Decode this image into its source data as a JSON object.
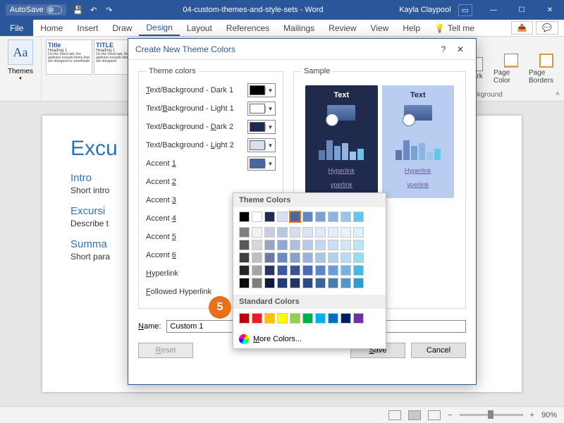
{
  "titlebar": {
    "autosave": "AutoSave",
    "document": "04-custom-themes-and-style-sets - Word",
    "user": "Kayla Claypool"
  },
  "tabs": [
    "File",
    "Home",
    "Insert",
    "Draw",
    "Design",
    "Layout",
    "References",
    "Mailings",
    "Review",
    "View",
    "Help"
  ],
  "active_tab": "Design",
  "tellme": "Tell me",
  "ribbon": {
    "themes": "Themes",
    "style1_title": "Title",
    "style1_h": "Heading 1",
    "style2_title": "TITLE",
    "style2_h": "Heading 1",
    "watermark": "nark",
    "pagecolor": "Page Color",
    "borders": "Page Borders",
    "group": "age Background"
  },
  "doc": {
    "h1": "Excu",
    "h2a": "Intro",
    "p1": "Short intro",
    "h2b": "Excursi",
    "p2": "Describe t",
    "h2c": "Summa",
    "p3": "Short para"
  },
  "dialog": {
    "title": "Create New Theme Colors",
    "themecolors": "Theme colors",
    "sample": "Sample",
    "rows": [
      {
        "label_pre": "",
        "u": "T",
        "label_post": "ext/Background - Dark 1",
        "color": "#000000"
      },
      {
        "label_pre": "Text/",
        "u": "B",
        "label_post": "ackground - Light 1",
        "color": "#ffffff"
      },
      {
        "label_pre": "Text/Background - ",
        "u": "D",
        "label_post": "ark 2",
        "color": "#1f2a4d"
      },
      {
        "label_pre": "Text/Background - ",
        "u": "L",
        "label_post": "ight 2",
        "color": "#d6e0f0"
      },
      {
        "label_pre": "Accent ",
        "u": "1",
        "label_post": "",
        "color": "#4a66a0"
      },
      {
        "label_pre": "Accent ",
        "u": "2",
        "label_post": "",
        "color": ""
      },
      {
        "label_pre": "Accent ",
        "u": "3",
        "label_post": "",
        "color": ""
      },
      {
        "label_pre": "Accent ",
        "u": "4",
        "label_post": "",
        "color": ""
      },
      {
        "label_pre": "Accent ",
        "u": "5",
        "label_post": "",
        "color": ""
      },
      {
        "label_pre": "Accent ",
        "u": "6",
        "label_post": "",
        "color": ""
      },
      {
        "label_pre": "",
        "u": "H",
        "label_post": "yperlink",
        "color": ""
      },
      {
        "label_pre": "",
        "u": "F",
        "label_post": "ollowed Hyperlink",
        "color": "#4aa0d8"
      }
    ],
    "sample_text": "Text",
    "sample_hl": "Hyperlink",
    "sample_fhl": "yperlink",
    "name_label": "Name:",
    "name_value": "Custom 1",
    "reset": "Reset",
    "save": "Save",
    "cancel": "Cancel"
  },
  "picker": {
    "theme_hdr": "Theme Colors",
    "std_hdr": "Standard Colors",
    "more": "More Colors...",
    "theme_row1": [
      "#000000",
      "#ffffff",
      "#1f2a4d",
      "#d6e0f0",
      "#4a66a0",
      "#6385c0",
      "#7ba0d4",
      "#8fb5de",
      "#9ec5e6",
      "#66c5e8"
    ],
    "tints": [
      [
        "#7f7f7f",
        "#f2f2f2",
        "#c9cee0",
        "#b9c7e0",
        "#d6ddec",
        "#dbe4f2",
        "#e0eaf6",
        "#e4eef8",
        "#e7f2fa",
        "#daf2fa"
      ],
      [
        "#595959",
        "#d8d8d8",
        "#9aa4c4",
        "#92a8d0",
        "#b0bfde",
        "#bacbe8",
        "#c4d8ef",
        "#cce0f2",
        "#d1e7f6",
        "#b9e7f6"
      ],
      [
        "#3f3f3f",
        "#bfbfbf",
        "#6b78a6",
        "#6b8ac0",
        "#8aa0ce",
        "#98b3dc",
        "#a8c6e6",
        "#b3d2ec",
        "#bbdcf1",
        "#98dcf2"
      ],
      [
        "#262626",
        "#a5a5a5",
        "#2c3560",
        "#3b5aa0",
        "#3a5490",
        "#4a6cac",
        "#5b87c2",
        "#6a9ed0",
        "#79b2dc",
        "#4ab8e0"
      ],
      [
        "#0c0c0c",
        "#7f7f7f",
        "#121a38",
        "#233c78",
        "#233660",
        "#2e4a82",
        "#3c6398",
        "#4a7cb0",
        "#5894c4",
        "#2e9ccc"
      ]
    ],
    "std": [
      "#c00000",
      "#ed1c24",
      "#ffc000",
      "#ffff00",
      "#92d050",
      "#00b050",
      "#00b0f0",
      "#0070c0",
      "#002060",
      "#7030a0"
    ]
  },
  "badge": "5",
  "status": {
    "zoom": "90%"
  }
}
